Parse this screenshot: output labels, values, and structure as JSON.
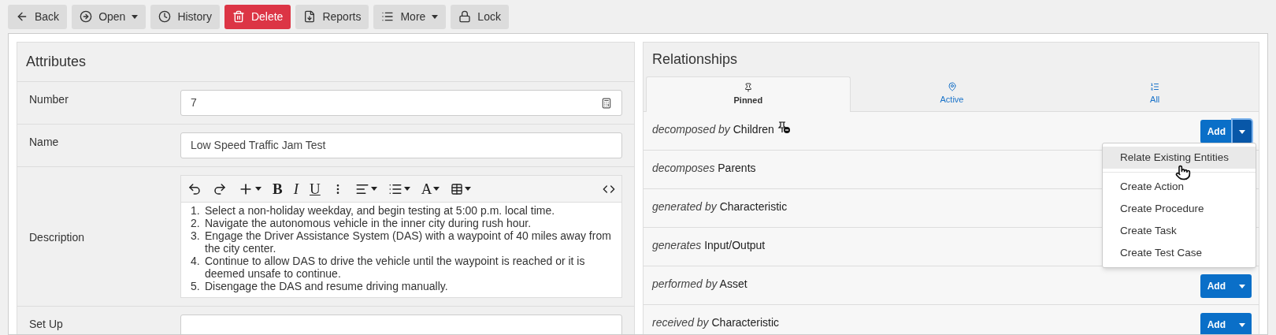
{
  "toolbar": [
    {
      "label": "Back",
      "kind": "back",
      "caret": false
    },
    {
      "label": "Open",
      "kind": "open",
      "caret": true
    },
    {
      "label": "History",
      "kind": "history",
      "caret": false
    },
    {
      "label": "Delete",
      "kind": "delete",
      "caret": false
    },
    {
      "label": "Reports",
      "kind": "reports",
      "caret": false
    },
    {
      "label": "More",
      "kind": "more",
      "caret": true
    },
    {
      "label": "Lock",
      "kind": "lock",
      "caret": false
    }
  ],
  "attributes": {
    "title": "Attributes",
    "fields": [
      {
        "kind": "number",
        "label": "Number",
        "value": "7"
      },
      {
        "kind": "text",
        "label": "Name",
        "value": "Low Speed Traffic Jam Test"
      },
      {
        "kind": "richtext",
        "label": "Description",
        "editor_toolbar": [
          "B",
          "I",
          "U",
          "A"
        ],
        "items": [
          {
            "marker": "1.",
            "text": "Select a non-holiday weekday, and begin testing at 5:00 p.m. local time."
          },
          {
            "marker": "2.",
            "text": "Navigate the autonomous vehicle in the inner city during rush hour."
          },
          {
            "marker": "3.",
            "text": "Engage the Driver Assistance System (DAS) with a waypoint of 40 miles away from the city center."
          },
          {
            "marker": "4.",
            "text": "Continue to allow DAS to drive the vehicle until the waypoint is reached or it is deemed unsafe to continue."
          },
          {
            "marker": "5.",
            "text": "Disengage the DAS and resume driving manually."
          }
        ]
      },
      {
        "kind": "text",
        "label": "Set Up"
      }
    ]
  },
  "relationships": {
    "title": "Relationships",
    "tabs": [
      {
        "label": "Pinned",
        "kind": "pin",
        "selected": true
      },
      {
        "label": "Active",
        "kind": "active",
        "selected": false
      },
      {
        "label": "All",
        "kind": "list",
        "selected": false
      }
    ],
    "rows": [
      {
        "verb": "decomposed by",
        "target": "Children",
        "pinned": true,
        "add_label": "Add",
        "toggle_focused": true
      },
      {
        "verb": "decomposes",
        "target": "Parents",
        "pinned": false
      },
      {
        "verb": "generated by",
        "target": "Characteristic",
        "pinned": false
      },
      {
        "verb": "generates",
        "target": "Input/Output",
        "pinned": false
      },
      {
        "verb": "performed by",
        "target": "Asset",
        "pinned": false,
        "add_label": "Add",
        "toggle_focused": false
      },
      {
        "verb": "received by",
        "target": "Characteristic",
        "pinned": false,
        "add_label": "Add",
        "toggle_focused": false
      }
    ],
    "menu": [
      {
        "label": "Relate Existing Entities",
        "selected": true
      },
      {
        "label": "Create Action",
        "selected": false
      },
      {
        "label": "Create Procedure",
        "selected": false
      },
      {
        "label": "Create Task",
        "selected": false
      },
      {
        "label": "Create Test Case",
        "selected": false
      }
    ]
  }
}
